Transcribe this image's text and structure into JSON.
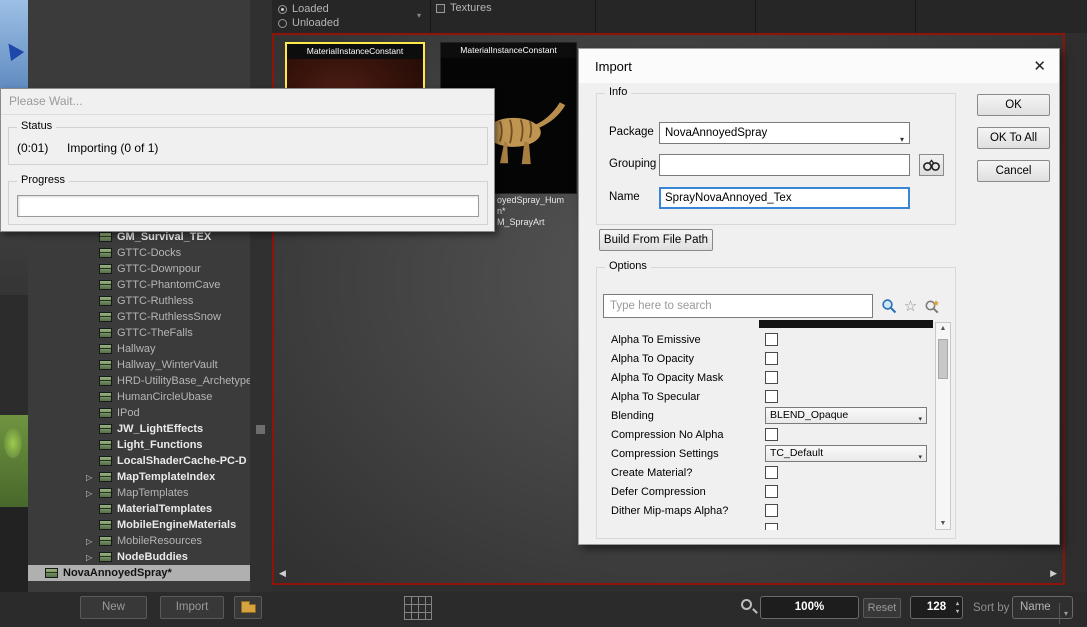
{
  "colors": {
    "canvas_border": "#8e1309",
    "selection_border": "#ffe94a",
    "focus_blue": "#3a86d4"
  },
  "ui_icons": {
    "expander": "▷",
    "combo_arrow": "▾",
    "scroll_up": "▲",
    "scroll_down": "▼",
    "scroll_left": "◀",
    "scroll_right": "▶",
    "star": "☆",
    "close": "✕",
    "spin_up": "▴",
    "spin_down": "▾"
  },
  "filter_bar": {
    "loaded_label": "Loaded",
    "unloaded_label": "Unloaded",
    "textures_label": "Textures"
  },
  "package_tree": {
    "items": [
      {
        "label": "GM_Survival_TEX",
        "bold": true,
        "expander": false,
        "indent": true,
        "selected": false
      },
      {
        "label": "GTTC-Docks",
        "bold": false,
        "expander": false,
        "indent": true,
        "selected": false
      },
      {
        "label": "GTTC-Downpour",
        "bold": false,
        "expander": false,
        "indent": true,
        "selected": false
      },
      {
        "label": "GTTC-PhantomCave",
        "bold": false,
        "expander": false,
        "indent": true,
        "selected": false
      },
      {
        "label": "GTTC-Ruthless",
        "bold": false,
        "expander": false,
        "indent": true,
        "selected": false
      },
      {
        "label": "GTTC-RuthlessSnow",
        "bold": false,
        "expander": false,
        "indent": true,
        "selected": false
      },
      {
        "label": "GTTC-TheFalls",
        "bold": false,
        "expander": false,
        "indent": true,
        "selected": false
      },
      {
        "label": "Hallway",
        "bold": false,
        "expander": false,
        "indent": true,
        "selected": false
      },
      {
        "label": "Hallway_WinterVault",
        "bold": false,
        "expander": false,
        "indent": true,
        "selected": false
      },
      {
        "label": "HRD-UtilityBase_Archetypes",
        "bold": false,
        "expander": false,
        "indent": true,
        "selected": false
      },
      {
        "label": "HumanCircleUbase",
        "bold": false,
        "expander": false,
        "indent": true,
        "selected": false
      },
      {
        "label": "IPod",
        "bold": false,
        "expander": false,
        "indent": true,
        "selected": false
      },
      {
        "label": "JW_LightEffects",
        "bold": true,
        "expander": false,
        "indent": true,
        "selected": false
      },
      {
        "label": "Light_Functions",
        "bold": true,
        "expander": false,
        "indent": true,
        "selected": false
      },
      {
        "label": "LocalShaderCache-PC-D",
        "bold": true,
        "expander": false,
        "indent": true,
        "selected": false
      },
      {
        "label": "MapTemplateIndex",
        "bold": true,
        "expander": true,
        "indent": true,
        "selected": false
      },
      {
        "label": "MapTemplates",
        "bold": false,
        "expander": true,
        "indent": true,
        "selected": false
      },
      {
        "label": "MaterialTemplates",
        "bold": true,
        "expander": false,
        "indent": true,
        "selected": false
      },
      {
        "label": "MobileEngineMaterials",
        "bold": true,
        "expander": false,
        "indent": true,
        "selected": false
      },
      {
        "label": "MobileResources",
        "bold": false,
        "expander": true,
        "indent": true,
        "selected": false
      },
      {
        "label": "NodeBuddies",
        "bold": true,
        "expander": true,
        "indent": true,
        "selected": false
      },
      {
        "label": "NovaAnnoyedSpray*",
        "bold": true,
        "expander": false,
        "indent": false,
        "selected": true
      }
    ]
  },
  "package_toolbar": {
    "new_label": "New",
    "import_label": "Import"
  },
  "assets": {
    "tiles": [
      {
        "type_label": "MaterialInstanceConstant",
        "selected": true
      },
      {
        "type_label": "MaterialInstanceConstant",
        "selected": false
      }
    ],
    "tile2_label_lines": [
      "oyedSpray_Hum",
      "n*",
      "M_SprayArt"
    ]
  },
  "please_wait": {
    "title": "Please Wait...",
    "status_group": "Status",
    "time": "(0:01)",
    "status_text": "Importing (0 of 1)",
    "progress_group": "Progress"
  },
  "import_dialog": {
    "title": "Import",
    "info_group": "Info",
    "package_label": "Package",
    "package_value": "NovaAnnoyedSpray",
    "grouping_label": "Grouping",
    "grouping_value": "",
    "name_label": "Name",
    "name_value": "SprayNovaAnnoyed_Tex",
    "build_button": "Build From File Path",
    "options_group": "Options",
    "search_placeholder": "Type here to search",
    "ok_button": "OK",
    "ok_to_all_button": "OK To All",
    "cancel_button": "Cancel",
    "options_rows": [
      {
        "label": "Alpha To Emissive",
        "type": "checkbox",
        "checked": false
      },
      {
        "label": "Alpha To Opacity",
        "type": "checkbox",
        "checked": false
      },
      {
        "label": "Alpha To Opacity Mask",
        "type": "checkbox",
        "checked": false
      },
      {
        "label": "Alpha To Specular",
        "type": "checkbox",
        "checked": false
      },
      {
        "label": "Blending",
        "type": "dropdown",
        "value": "BLEND_Opaque"
      },
      {
        "label": "Compression No Alpha",
        "type": "checkbox",
        "checked": false
      },
      {
        "label": "Compression Settings",
        "type": "dropdown",
        "value": "TC_Default"
      },
      {
        "label": "Create Material?",
        "type": "checkbox",
        "checked": false
      },
      {
        "label": "Defer Compression",
        "type": "checkbox",
        "checked": false
      },
      {
        "label": "Dither Mip-maps Alpha?",
        "type": "checkbox",
        "checked": false
      },
      {
        "label": "",
        "type": "checkbox",
        "checked": false
      }
    ]
  },
  "bottom_bar": {
    "zoom_value": "100%",
    "reset_label": "Reset",
    "size_value": "128",
    "sort_by_label": "Sort by",
    "sort_value": "Name"
  }
}
